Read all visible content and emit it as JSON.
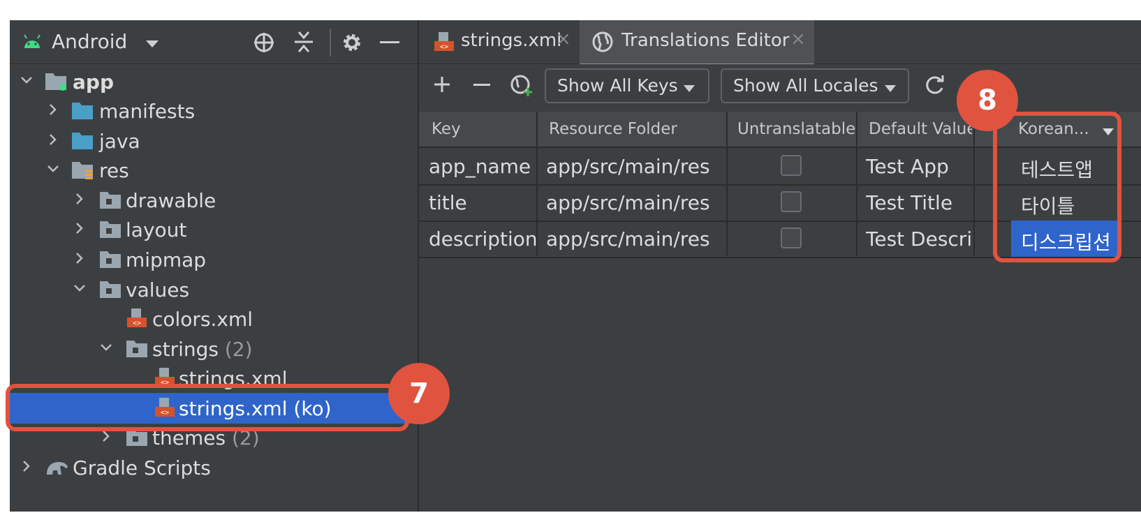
{
  "project": {
    "title": "Android",
    "tree": [
      {
        "label": "app",
        "count": ""
      },
      {
        "label": "manifests",
        "count": ""
      },
      {
        "label": "java",
        "count": ""
      },
      {
        "label": "res",
        "count": ""
      },
      {
        "label": "drawable",
        "count": ""
      },
      {
        "label": "layout",
        "count": ""
      },
      {
        "label": "mipmap",
        "count": ""
      },
      {
        "label": "values",
        "count": ""
      },
      {
        "label": "colors.xml",
        "count": ""
      },
      {
        "label": "strings",
        "count": "(2)"
      },
      {
        "label": "strings.xml",
        "count": ""
      },
      {
        "label": "strings.xml (ko)",
        "count": ""
      },
      {
        "label": "themes",
        "count": "(2)"
      },
      {
        "label": "Gradle Scripts",
        "count": ""
      }
    ]
  },
  "tabs": [
    {
      "label": "strings.xml",
      "close": "×"
    },
    {
      "label": "Translations Editor",
      "close": "×"
    }
  ],
  "toolbar": {
    "show_keys": "Show All Keys",
    "show_locales": "Show All Locales"
  },
  "table": {
    "headers": [
      "Key",
      "Resource Folder",
      "Untranslatable",
      "Default Value",
      "Korean..."
    ],
    "rows": [
      {
        "key": "app_name",
        "folder": "app/src/main/res",
        "default": "Test App",
        "korean": "테스트앱"
      },
      {
        "key": "title",
        "folder": "app/src/main/res",
        "default": "Test Title",
        "korean": "타이틀"
      },
      {
        "key": "description",
        "folder": "app/src/main/res",
        "default": "Test Descri",
        "korean": "디스크립션"
      }
    ]
  },
  "badges": {
    "step7": "7",
    "step8": "8"
  },
  "colors": {
    "selection": "#2f65ca",
    "highlight": "#e0533f",
    "panel": "#3c3f41"
  }
}
